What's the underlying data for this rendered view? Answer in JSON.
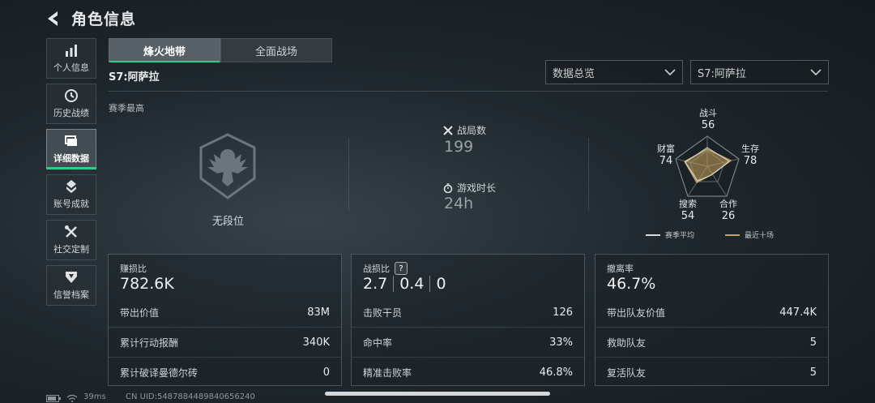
{
  "header": {
    "title": "角色信息"
  },
  "sidebar": {
    "items": [
      {
        "label": "个人信息",
        "icon": "bar-chart-icon"
      },
      {
        "label": "历史战绩",
        "icon": "history-icon"
      },
      {
        "label": "详细数据",
        "icon": "folder-icon",
        "active": true
      },
      {
        "label": "账号成就",
        "icon": "achievement-icon"
      },
      {
        "label": "社交定制",
        "icon": "tools-icon"
      },
      {
        "label": "信誉档案",
        "icon": "badge-icon"
      }
    ]
  },
  "tabs": [
    {
      "label": "烽火地带",
      "active": true
    },
    {
      "label": "全面战场",
      "active": false
    }
  ],
  "season": "S7:阿萨拉",
  "filters": {
    "data_view": "数据总览",
    "season_select": "S7:阿萨拉"
  },
  "season_best": {
    "label": "赛季最高",
    "rank": "无段位"
  },
  "summary": {
    "matches_label": "战局数",
    "matches_value": "199",
    "playtime_label": "游戏时长",
    "playtime_value": "24h"
  },
  "radar": {
    "axes": [
      {
        "label": "战斗",
        "value": "56"
      },
      {
        "label": "生存",
        "value": "78"
      },
      {
        "label": "合作",
        "value": "26"
      },
      {
        "label": "搜索",
        "value": "54"
      },
      {
        "label": "财富",
        "value": "74"
      }
    ],
    "legend": [
      {
        "label": "赛季平均",
        "color": "#d8dcde"
      },
      {
        "label": "最近十场",
        "color": "#c8a45a"
      }
    ]
  },
  "cards": {
    "profit": {
      "title": "赚损比",
      "value": "782.6K",
      "rows": [
        {
          "label": "带出价值",
          "value": "83M"
        },
        {
          "label": "累计行动报酬",
          "value": "340K"
        },
        {
          "label": "累计破译曼德尔砖",
          "value": "0"
        }
      ]
    },
    "combat": {
      "title": "战损比",
      "help": "?",
      "ratios": [
        "2.7",
        "0.4",
        "0"
      ],
      "rows": [
        {
          "label": "击败干员",
          "value": "126"
        },
        {
          "label": "命中率",
          "value": "33%"
        },
        {
          "label": "精准击败率",
          "value": "46.8%"
        }
      ]
    },
    "extract": {
      "title": "撤离率",
      "value": "46.7%",
      "rows": [
        {
          "label": "带出队友价值",
          "value": "447.4K"
        },
        {
          "label": "救助队友",
          "value": "5"
        },
        {
          "label": "复活队友",
          "value": "5"
        }
      ]
    }
  },
  "footer": {
    "ping": "39ms",
    "uid": "CN UID:5487884489840656240"
  },
  "colors": {
    "accent": "#29d08c",
    "radar_fill": "#c8a45a"
  }
}
